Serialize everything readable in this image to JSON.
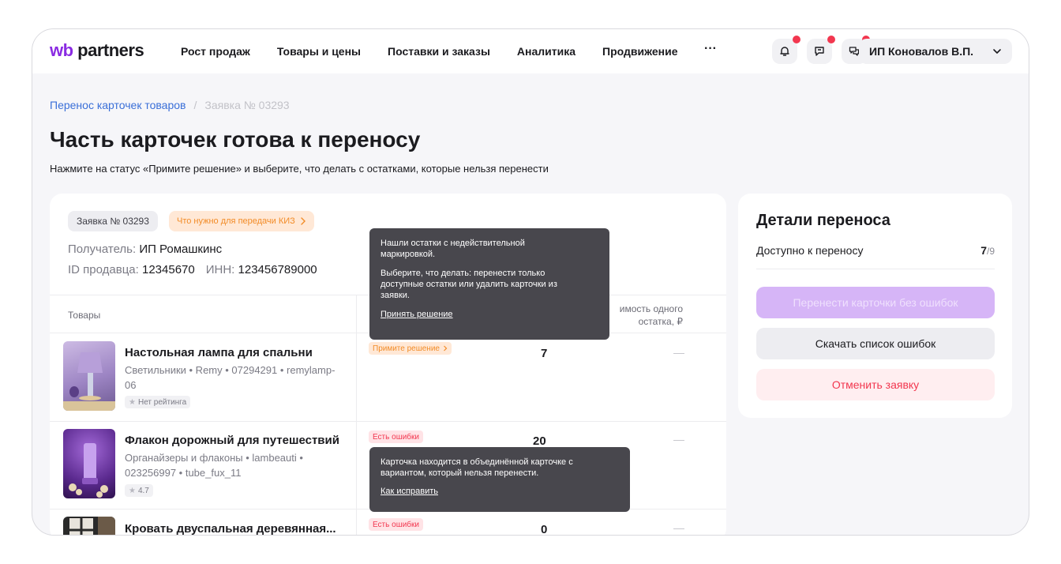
{
  "header": {
    "logo_prefix": "wb",
    "logo_suffix": " partners",
    "nav": [
      "Рост продаж",
      "Товары и цены",
      "Поставки и заказы",
      "Аналитика",
      "Продвижение"
    ],
    "more": "···",
    "user": "ИП Коновалов В.П.",
    "icons": [
      "bell-icon",
      "feedback-icon",
      "chat-icon"
    ],
    "notification_color": "#f2374f"
  },
  "breadcrumbs": {
    "link": "Перенос карточек товаров",
    "separator": "/",
    "current": "Заявка № 03293"
  },
  "page": {
    "title": "Часть карточек готова к переносу",
    "subtitle": "Нажмите на статус «Примите решение» и выберите, что делать с остатками, которые нельзя перенести"
  },
  "request": {
    "number_tag": "Заявка № 03293",
    "kiz_tag": "Что нужно для передачи КИЗ",
    "recipient_label": "Получатель:",
    "recipient_value": "ИП Ромашкинс",
    "seller_id_label": "ID продавца:",
    "seller_id_value": "12345670",
    "inn_label": "ИНН:",
    "inn_value": "123456789000"
  },
  "table": {
    "col_goods": "Товары",
    "col_cost_line1": "имость одного",
    "col_cost_line2": "остатка, ₽",
    "rows": [
      {
        "name": "Настольная лампа для спальни",
        "meta": "Светильники • Remy • 07294291 • remylamp-06",
        "rating": "Нет рейтинга",
        "status": "Примите решение",
        "qty": "7"
      },
      {
        "name": "Флакон дорожный для путешествий",
        "meta": "Органайзеры и флаконы • lambeauti • 023256997 • tube_fux_11",
        "rating": "4.7",
        "status": "Есть ошибки",
        "qty": "20"
      },
      {
        "name": "Кровать двуспальная деревянная...",
        "status": "Есть ошибки",
        "qty": "0"
      }
    ]
  },
  "tooltips": {
    "first": {
      "line1": "Нашли остатки с недействительной маркировкой.",
      "line2": "Выберите, что делать: перенести только доступные остатки или удалить карточки из заявки.",
      "link": "Принять решение"
    },
    "second": {
      "line1": "Карточка находится в объединённой карточке с вариантом, который нельзя перенести.",
      "link": "Как исправить"
    }
  },
  "side": {
    "title": "Детали переноса",
    "available_label": "Доступно к переносу",
    "available_count": "7",
    "available_total": "/9",
    "btn_transfer": "Перенести карточки без ошибок",
    "btn_download": "Скачать список ошибок",
    "btn_cancel": "Отменить заявку",
    "accent_color": "#8a2be2"
  }
}
